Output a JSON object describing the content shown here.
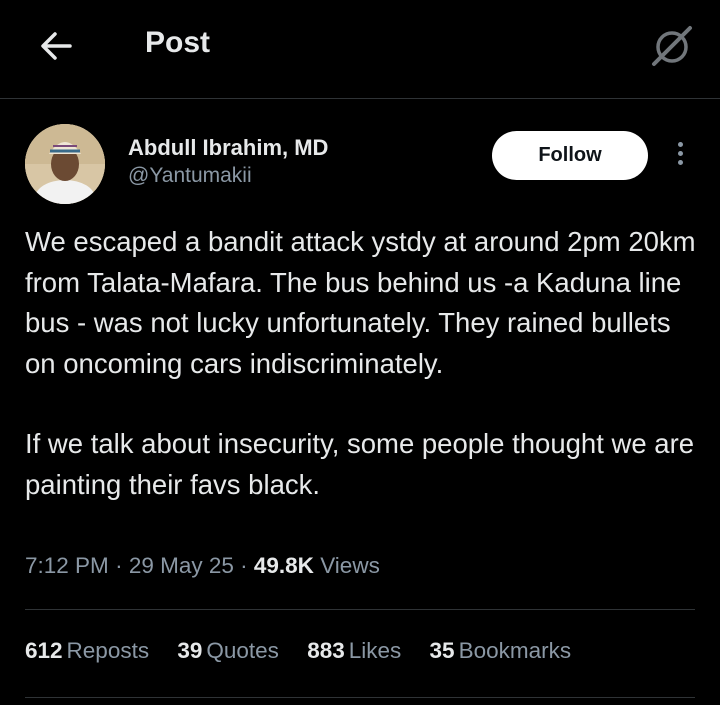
{
  "header": {
    "title": "Post",
    "back_icon": "arrow-left-icon",
    "grok_icon": "grok-icon"
  },
  "author": {
    "name": "Abdull Ibrahim, MD",
    "handle": "@Yantumakii",
    "follow_label": "Follow"
  },
  "post": {
    "paragraphs": [
      "We escaped a bandit attack ystdy at around 2pm 20km from Talata-Mafara. The bus behind us -a Kaduna line bus - was not lucky unfortunately. They rained bullets on oncoming cars indiscriminately.",
      "If we talk about insecurity, some people thought we are painting their favs black."
    ],
    "time": "7:12 PM",
    "date": "29 May 25",
    "views_count": "49.8K",
    "views_label": "Views"
  },
  "stats": [
    {
      "count": "612",
      "label": "Reposts"
    },
    {
      "count": "39",
      "label": "Quotes"
    },
    {
      "count": "883",
      "label": "Likes"
    },
    {
      "count": "35",
      "label": "Bookmarks"
    }
  ],
  "colors": {
    "background": "#000000",
    "text": "#e7e9ea",
    "secondary": "#8b98a5",
    "divider": "#2f3336"
  }
}
